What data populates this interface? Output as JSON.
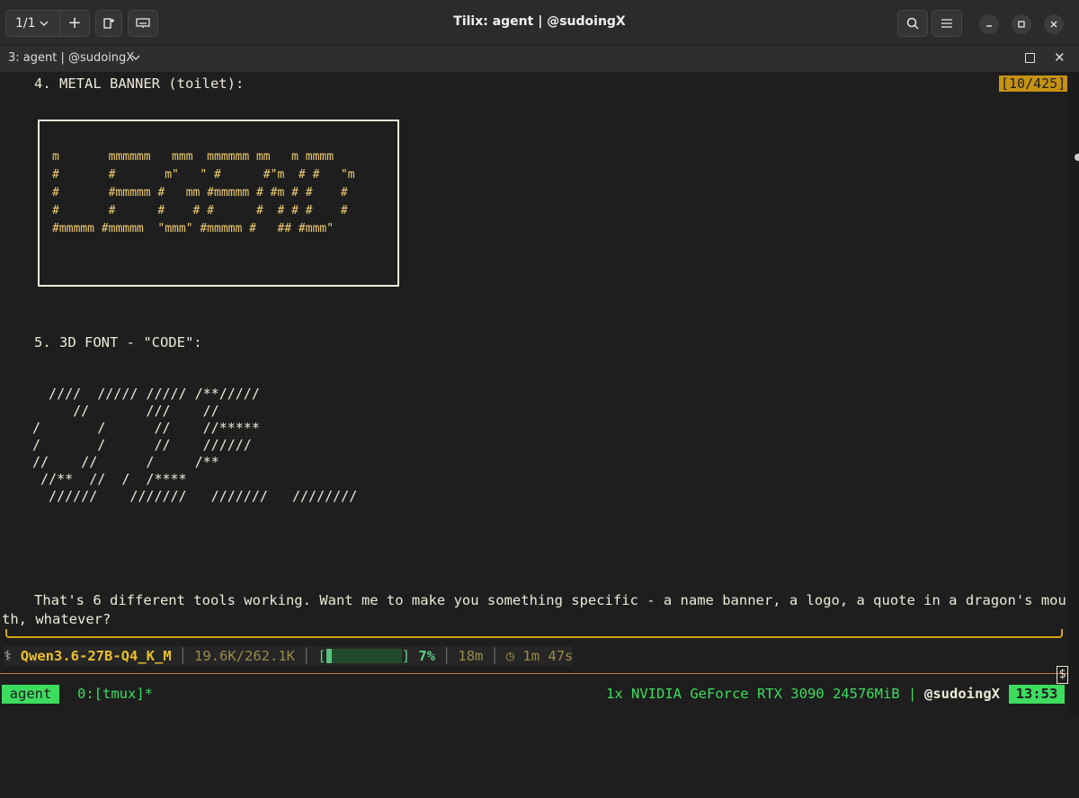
{
  "titlebar": {
    "session_label": "1/1",
    "title": "Tilix: agent | @sudoingX"
  },
  "tab": {
    "label": "3: agent | @sudoingX"
  },
  "terminal": {
    "counter": "[10/425]",
    "heading4": "4. METAL BANNER (toilet):",
    "banner_art": "m       mmmmmm   mmm  mmmmmm mm   m mmmm\n#       #       m\"   \" #      #\"m  # #   \"m\n#       #mmmmm #   mm #mmmmm # #m # #    #\n#       #      #    # #      #  # # #    #\n#mmmmm #mmmmm  \"mmm\" #mmmmm #   ## #mmm\"",
    "heading5": "5. 3D FONT - \"CODE\":",
    "code_art": "  ////  ///// ///// /**/////\n     //       ///    //\n/       /      //    //*****\n/       /      //    //////\n//    //      /     /**\n //**  //  /  /****\n  //////    ///////   ///////   ////////",
    "message_line1": "That's 6 different tools working. Want me to make you something specific - a name banner, a logo, a quote in a dragon's mou",
    "message_line2": "th, whatever?"
  },
  "statusline": {
    "icon": "⚕",
    "model": "Qwen3.6-27B-Q4_K_M",
    "tokens": "19.6K/262.1K",
    "bracket_open": "[",
    "bracket_close": "]",
    "progress_fraction": 0.07,
    "percent": "7%",
    "duration": "18m",
    "timer": "◷ 1m 47s"
  },
  "prompt": {
    "symbol": "$"
  },
  "tmux": {
    "session": "agent",
    "window": "0:[tmux]*",
    "gpu": "1x NVIDIA GeForce RTX 3090 24576MiB |",
    "user": "@sudoingX",
    "time": "13:53"
  },
  "colors": {
    "accent_yellow": "#d4a514",
    "tmux_green": "#3ddc5f",
    "progress_green": "#59c07a",
    "orange_rule": "#c9724d"
  }
}
